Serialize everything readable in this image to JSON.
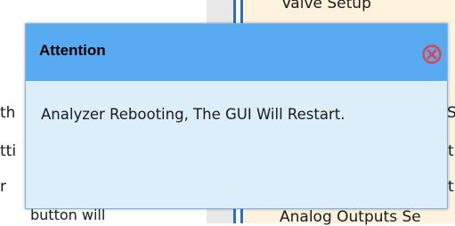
{
  "background": {
    "right_panel": {
      "top_item": "Valve Setup",
      "bottom_item": "Analog Outputs Se",
      "fragments": [
        "S",
        "t",
        "t"
      ]
    },
    "left_panel": {
      "fragments": [
        "th",
        "tti",
        "r",
        "button will"
      ]
    }
  },
  "dialog": {
    "title": "Attention",
    "message": "Analyzer Rebooting, The GUI Will Restart.",
    "close_icon": "close-circle-icon",
    "colors": {
      "header": "#58abf0",
      "body": "#ddeefb",
      "close": "#e04048"
    }
  }
}
